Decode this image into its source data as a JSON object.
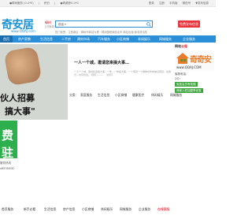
{
  "topbar": {
    "left_items": [
      "●樟树服务 (0-0*0)",
      "|",
      "积分",
      "|",
      "●奇葩获0-0*0"
    ],
    "right_items": [
      "登录",
      "注册",
      "手机版",
      "微信号",
      "▼发布信息"
    ]
  },
  "header": {
    "logo_text": "奇安居",
    "logo_url": "www.QQAJ.com",
    "city": "樟树",
    "switch_label": "[切换城市]",
    "search_category": "楼盘 ▾",
    "search_placeholder": "",
    "hot_words": "热门标签：江西新区 · 樟树市新站大厦 · 樟树国税局西出车 新站出租 新手房出售",
    "post_button": "免费发布信息"
  },
  "nav": {
    "items": [
      "首页",
      "房产家教",
      "生活信息",
      "二手房",
      "建材市场",
      "汽车服务",
      "小区商铺",
      "休闲娱乐",
      "网城服务",
      "企业服务"
    ]
  },
  "banner": {
    "line1": "伙人招募",
    "line2": "搞大事\""
  },
  "center": {
    "title": "一人一个城，邀请您来搞大事…",
    "desc": "一人一个城，邀请您来搞大事…一件…一件搞大事，一个项目一个群体合作的信息项目，在我们…共同创业。 持有 ——— （共同）"
  },
  "notice": {
    "head_a": "网站",
    "head_b": "公告",
    "brand": "奇奇安",
    "url": "www.QQAJ.COM",
    "phone": "客服电话：",
    "qq": "QQ：",
    "button1": "免费会员有效期",
    "button2": "商家入驻加盟享优惠"
  },
  "subnav": {
    "label": "分类：",
    "items": [
      "家庭服务",
      "生活信息",
      "小区商铺",
      "健康医疗",
      "休闲娱乐",
      "网城服务"
    ]
  },
  "sidead": {
    "char1": "费",
    "char2": "驻"
  },
  "contact": {
    "line1": "服务热线",
    "line2": "x8530000"
  },
  "footer": {
    "items": [
      "首页服务",
      "新手必看",
      "生活信息",
      "房产信息",
      "小区商铺",
      "休闲娱乐",
      "网城服务",
      "企业服务",
      "在线客服"
    ]
  },
  "colors": {
    "brand_blue": "#2a8fd6",
    "accent_red": "#e8333a",
    "green": "#2eaf4e"
  }
}
